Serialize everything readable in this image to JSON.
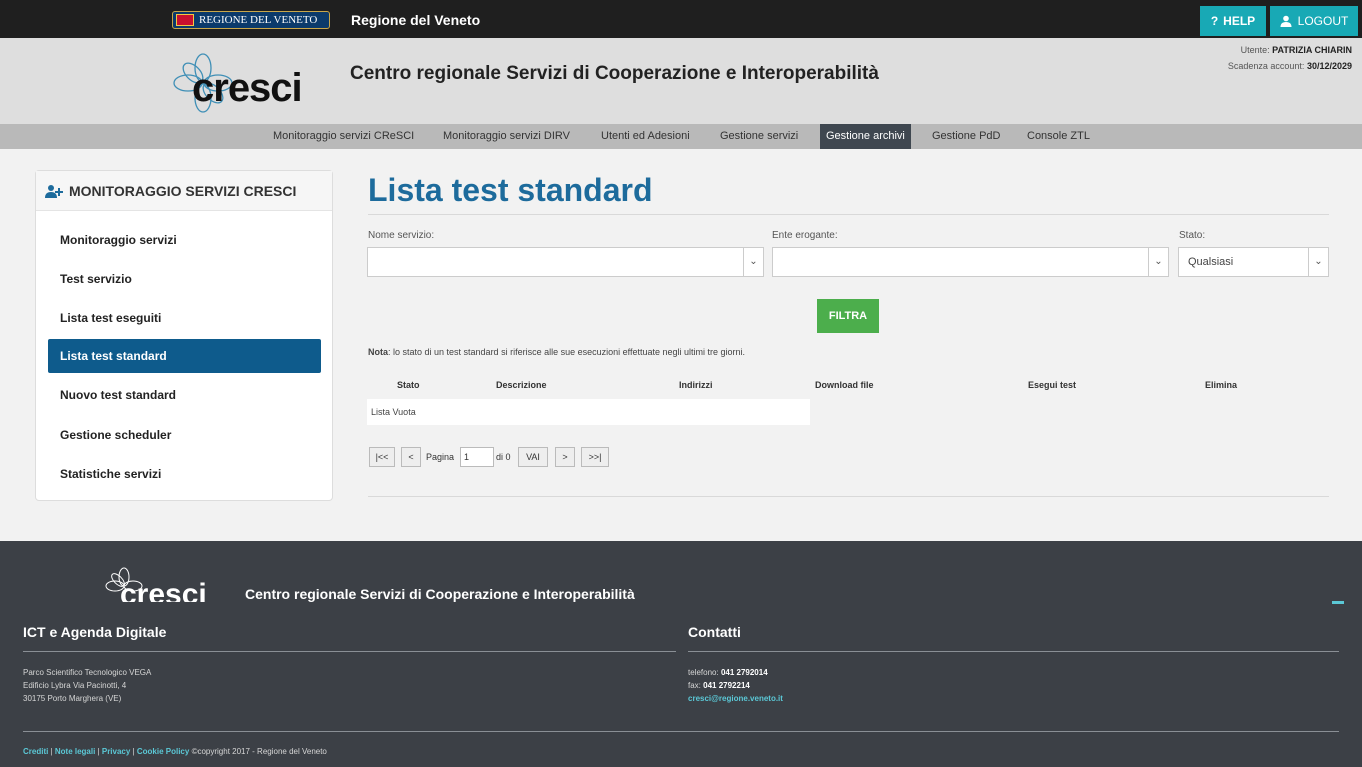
{
  "topbar": {
    "regione_logo": "REGIONE DEL VENETO",
    "title": "Regione del Veneto",
    "help": "HELP",
    "logout": "LOGOUT"
  },
  "header": {
    "logo_text": "cresci",
    "title": "Centro regionale Servizi di Cooperazione e Interoperabilità",
    "user_label": "Utente:",
    "user_name": "PATRIZIA CHIARIN",
    "expiry_label": "Scadenza account:",
    "expiry_date": "30/12/2029"
  },
  "nav": {
    "items": [
      {
        "label": "Monitoraggio servizi CReSCI"
      },
      {
        "label": "Monitoraggio servizi DIRV"
      },
      {
        "label": "Utenti ed Adesioni"
      },
      {
        "label": "Gestione servizi"
      },
      {
        "label": "Gestione archivi"
      },
      {
        "label": "Gestione PdD"
      },
      {
        "label": "Console ZTL"
      }
    ],
    "active": "Gestione archivi"
  },
  "sidebar": {
    "title": "MONITORAGGIO SERVIZI CRESCI",
    "items": [
      {
        "label": "Monitoraggio servizi"
      },
      {
        "label": "Test servizio"
      },
      {
        "label": "Lista test eseguiti"
      },
      {
        "label": "Lista test standard"
      },
      {
        "label": "Nuovo test standard"
      },
      {
        "label": "Gestione scheduler"
      },
      {
        "label": "Statistiche servizi"
      }
    ],
    "active": "Lista test standard"
  },
  "main": {
    "title": "Lista test standard",
    "filters": {
      "nome_servizio_label": "Nome servizio:",
      "nome_servizio_value": "",
      "ente_label": "Ente erogante:",
      "ente_value": "",
      "stato_label": "Stato:",
      "stato_value": "Qualsiasi"
    },
    "filter_button": "FILTRA",
    "nota_bold": "Nota",
    "nota_text": ": lo stato di un test standard si riferisce alle sue esecuzioni effettuate negli ultimi tre giorni.",
    "table": {
      "headers": [
        "Stato",
        "Descrizione",
        "Indirizzi",
        "Download file",
        "Esegui test",
        "Elimina"
      ],
      "empty": "Lista Vuota"
    },
    "pagination": {
      "first": "|<<",
      "prev": "<",
      "page_label": "Pagina",
      "page_value": "1",
      "of_label": "di 0",
      "go": "VAI",
      "next": ">",
      "last": ">>|"
    }
  },
  "footer": {
    "logo_text": "cresci",
    "title": "Centro regionale Servizi di Cooperazione e Interoperabilità",
    "left_heading": "ICT e Agenda Digitale",
    "address_1": "Parco Scientifico Tecnologico VEGA",
    "address_2": "Edificio Lybra Via Pacinotti, 4",
    "address_3": "30175 Porto Marghera (VE)",
    "right_heading": "Contatti",
    "phone_label": "telefono:",
    "phone": "041 2792014",
    "fax_label": "fax:",
    "fax": "041 2792214",
    "email": "cresci@regione.veneto.it",
    "links": [
      "Crediti",
      "Note legali",
      "Privacy",
      "Cookie Policy"
    ],
    "copyright": "©copyright 2017 - Regione del Veneto"
  }
}
